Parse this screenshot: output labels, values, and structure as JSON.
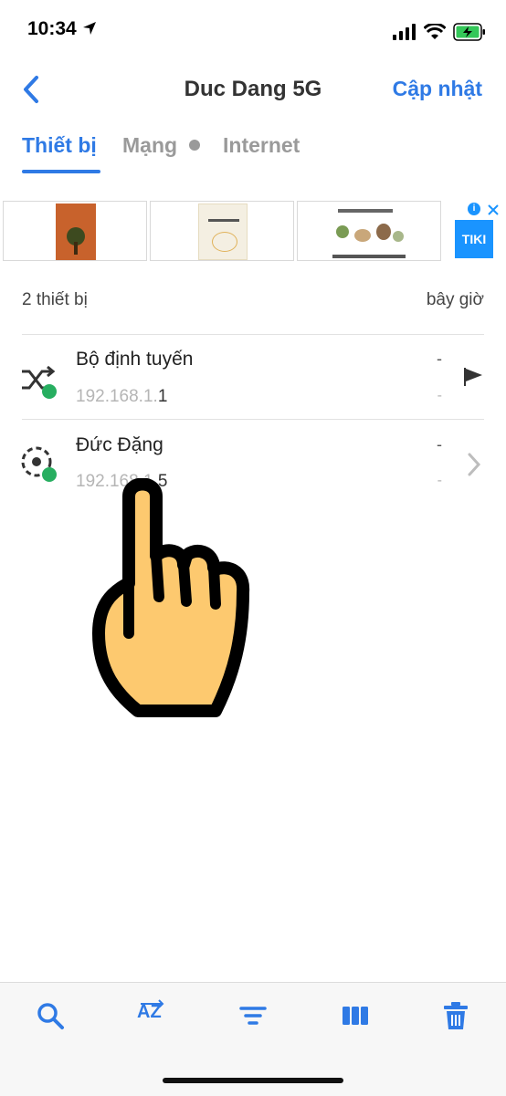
{
  "status_bar": {
    "time": "10:34"
  },
  "header": {
    "title": "Duc Dang 5G",
    "update_label": "Cập nhật"
  },
  "tabs": [
    {
      "label": "Thiết bị",
      "active": true
    },
    {
      "label": "Mạng",
      "active": false
    },
    {
      "label": "Internet",
      "active": false
    }
  ],
  "ad": {
    "brand": "TIKI"
  },
  "summary": {
    "count_label": "2 thiết bị",
    "time_label": "bây giờ"
  },
  "devices": [
    {
      "name": "Bộ định tuyến",
      "ip_prefix": "192.168.1.",
      "ip_suffix": "1",
      "dash1": "-",
      "dash2": "-"
    },
    {
      "name": "Đức Đặng",
      "ip_prefix": "192.168.1.",
      "ip_suffix": "5",
      "dash1": "-",
      "dash2": "-"
    }
  ],
  "toolbar": {
    "sort_label": "AZ"
  },
  "colors": {
    "accent": "#2f7ae5",
    "online": "#27ae60",
    "hand": "#fdc96f"
  }
}
